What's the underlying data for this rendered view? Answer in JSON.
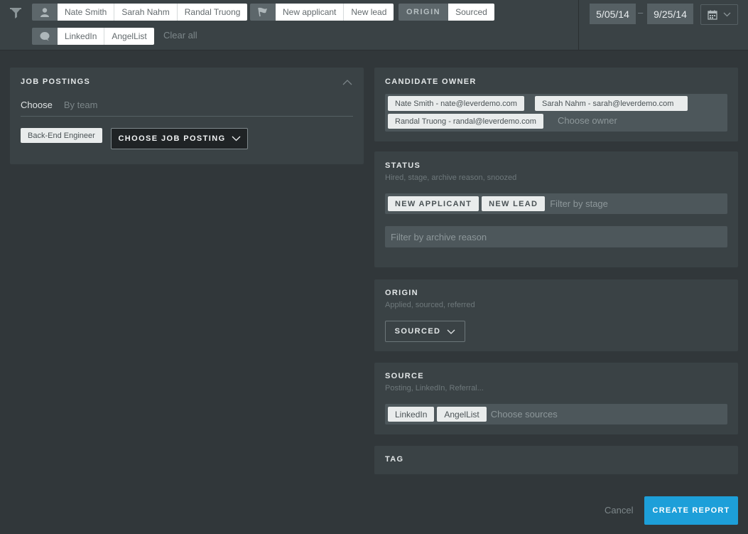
{
  "filters": {
    "owners": [
      "Nate Smith",
      "Sarah Nahm",
      "Randal Truong"
    ],
    "stages": [
      "New applicant",
      "New lead"
    ],
    "origin_label": "ORIGIN",
    "origin_value": "Sourced",
    "sources": [
      "LinkedIn",
      "AngelList"
    ],
    "clear_all": "Clear all"
  },
  "date_range": {
    "start": "5/05/14",
    "separator": "–",
    "end": "9/25/14"
  },
  "job_postings": {
    "title": "JOB POSTINGS",
    "tabs": [
      "Choose",
      "By team"
    ],
    "selected": [
      "Back-End Engineer"
    ],
    "button": "CHOOSE JOB POSTING"
  },
  "candidate_owner": {
    "title": "CANDIDATE OWNER",
    "tags": [
      "Nate Smith - nate@leverdemo.com",
      "Sarah Nahm - sarah@leverdemo.com",
      "Randal Truong - randal@leverdemo.com"
    ],
    "placeholder": "Choose owner"
  },
  "status": {
    "title": "STATUS",
    "subtitle": "Hired, stage, archive reason, snoozed",
    "stage_tags": [
      "NEW APPLICANT",
      "NEW LEAD"
    ],
    "stage_placeholder": "Filter by stage",
    "archive_placeholder": "Filter by archive reason"
  },
  "origin": {
    "title": "ORIGIN",
    "subtitle": "Applied, sourced, referred",
    "value": "SOURCED"
  },
  "source": {
    "title": "SOURCE",
    "subtitle": "Posting, LinkedIn, Referral...",
    "tags": [
      "LinkedIn",
      "AngelList"
    ],
    "placeholder": "Choose sources"
  },
  "tag": {
    "title": "TAG"
  },
  "actions": {
    "cancel": "Cancel",
    "create": "CREATE REPORT"
  },
  "colors": {
    "accent": "#1d9fd9",
    "background": "#31373a",
    "panel": "#3a4245"
  }
}
